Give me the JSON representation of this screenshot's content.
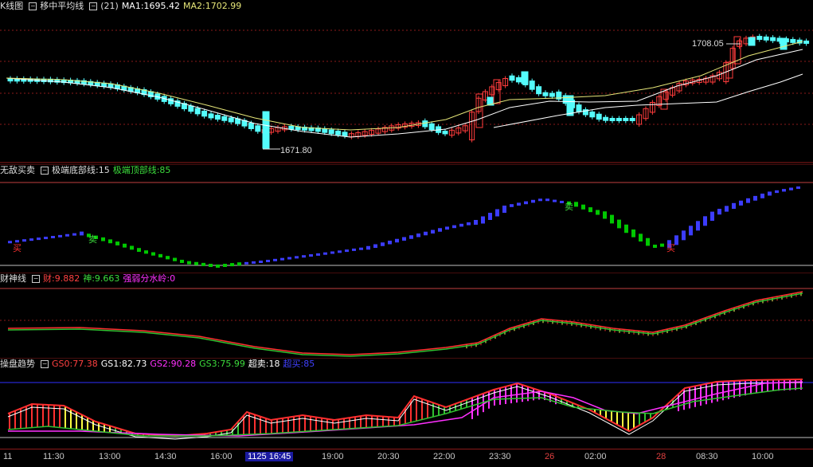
{
  "kline": {
    "title": "K线图",
    "indicator": "移中平均线",
    "params": "(21)",
    "ma1_label": "MA1:1695.42",
    "ma2_label": "MA2:1702.99",
    "high_label": "1708.05",
    "low_label": "1671.80"
  },
  "panel2": {
    "title": "无敌买卖",
    "bottom_label": "极端底部线:15",
    "top_label": "极端顶部线:85",
    "buy": "买",
    "sell": "卖"
  },
  "panel3": {
    "title": "财神线",
    "cai": "财:9.882",
    "shen": "神:9.663",
    "qiangruo": "强弱分水岭:0"
  },
  "panel4": {
    "title": "操盘趋势",
    "gs0": "GS0:77.38",
    "gs1": "GS1:82.73",
    "gs2": "GS2:90.28",
    "gs3": "GS3:75.99",
    "chaomai": "超卖:18",
    "chaomaiup": "超买:85"
  },
  "time_axis": [
    "11",
    "11:30",
    "13:00",
    "14:30",
    "16:00",
    "1125 16:45",
    "19:00",
    "20:30",
    "22:00",
    "23:30",
    "26",
    "02:00",
    "28",
    "08:30",
    "10:00"
  ],
  "colors": {
    "up": "#ff3c3c",
    "down": "#54fcfc",
    "ma_white": "#ffffff",
    "ma_yellow": "#e6e678",
    "grid": "#8b1a1a",
    "blue_bar": "#3c3cff",
    "green_bar": "#00c800",
    "magenta": "#ff30ff"
  },
  "chart_data": [
    {
      "type": "candlestick",
      "title": "移中平均线",
      "series_ma": [
        {
          "name": "MA1",
          "last": 1695.42
        },
        {
          "name": "MA2",
          "last": 1702.99
        }
      ],
      "annotations": [
        {
          "text": "1708.05"
        },
        {
          "text": "1671.80"
        }
      ]
    },
    {
      "type": "bar",
      "title": "无敌买卖"
    },
    {
      "type": "line",
      "title": "财神线"
    },
    {
      "type": "bar",
      "title": "操盘趋势"
    }
  ]
}
